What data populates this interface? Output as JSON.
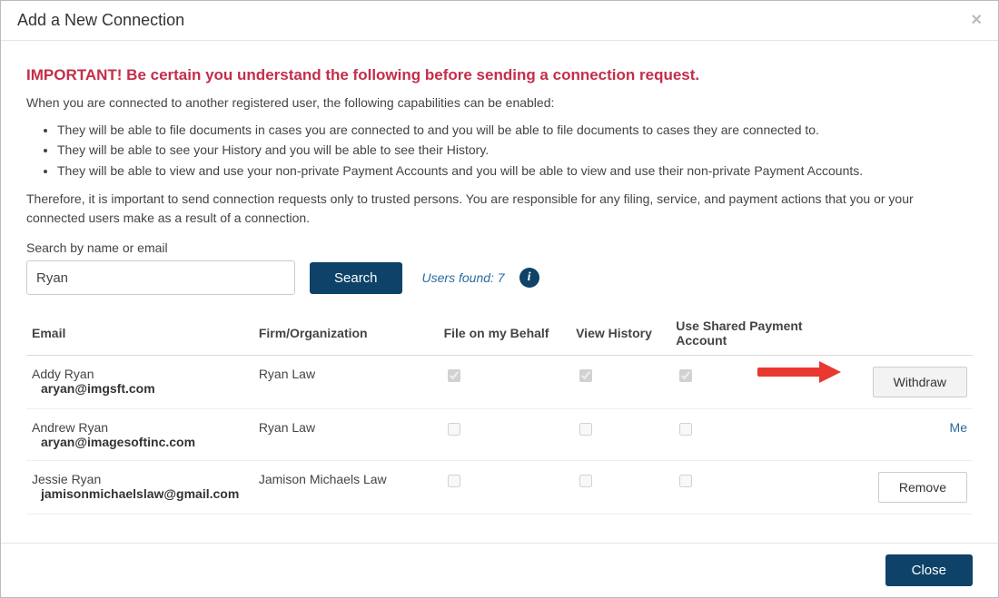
{
  "modal": {
    "title": "Add a New Connection",
    "close_x": "×"
  },
  "warning": {
    "heading": "IMPORTANT! Be certain you understand the following before sending a connection request.",
    "intro": "When you are connected to another registered user, the following capabilities can be enabled:",
    "bullets": [
      "They will be able to file documents in cases you are connected to and you will be able to file documents to cases they are connected to.",
      "They will be able to see your History and you will be able to see their History.",
      "They will be able to view and use your non-private Payment Accounts and you will be able to view and use their non-private Payment Accounts."
    ],
    "outro": "Therefore, it is important to send connection requests only to trusted persons. You are responsible for any filing, service, and payment actions that you or your connected users make as a result of a connection."
  },
  "search": {
    "label": "Search by name or email",
    "value": "Ryan",
    "button": "Search",
    "found_label": "Users found: 7",
    "info_glyph": "i"
  },
  "table": {
    "headers": {
      "email": "Email",
      "firm": "Firm/Organization",
      "file": "File on my Behalf",
      "history": "View History",
      "shared": "Use Shared Payment Account"
    },
    "rows": [
      {
        "name": "Addy Ryan",
        "email": "aryan@imgsft.com",
        "firm": "Ryan Law",
        "file": true,
        "history": true,
        "shared": true,
        "file_disabled": true,
        "history_disabled": true,
        "shared_disabled": true,
        "action_type": "button",
        "action_label": "Withdraw",
        "highlight": true,
        "arrow": true
      },
      {
        "name": "Andrew Ryan",
        "email": "aryan@imagesoftinc.com",
        "firm": "Ryan Law",
        "file": false,
        "history": false,
        "shared": false,
        "file_disabled": true,
        "history_disabled": true,
        "shared_disabled": true,
        "action_type": "text",
        "action_label": "Me"
      },
      {
        "name": "Jessie Ryan",
        "email": "jamisonmichaelslaw@gmail.com",
        "firm": "Jamison Michaels Law",
        "file": false,
        "history": false,
        "shared": false,
        "file_disabled": true,
        "history_disabled": true,
        "shared_disabled": true,
        "action_type": "button",
        "action_label": "Remove"
      }
    ]
  },
  "footer": {
    "close": "Close"
  }
}
